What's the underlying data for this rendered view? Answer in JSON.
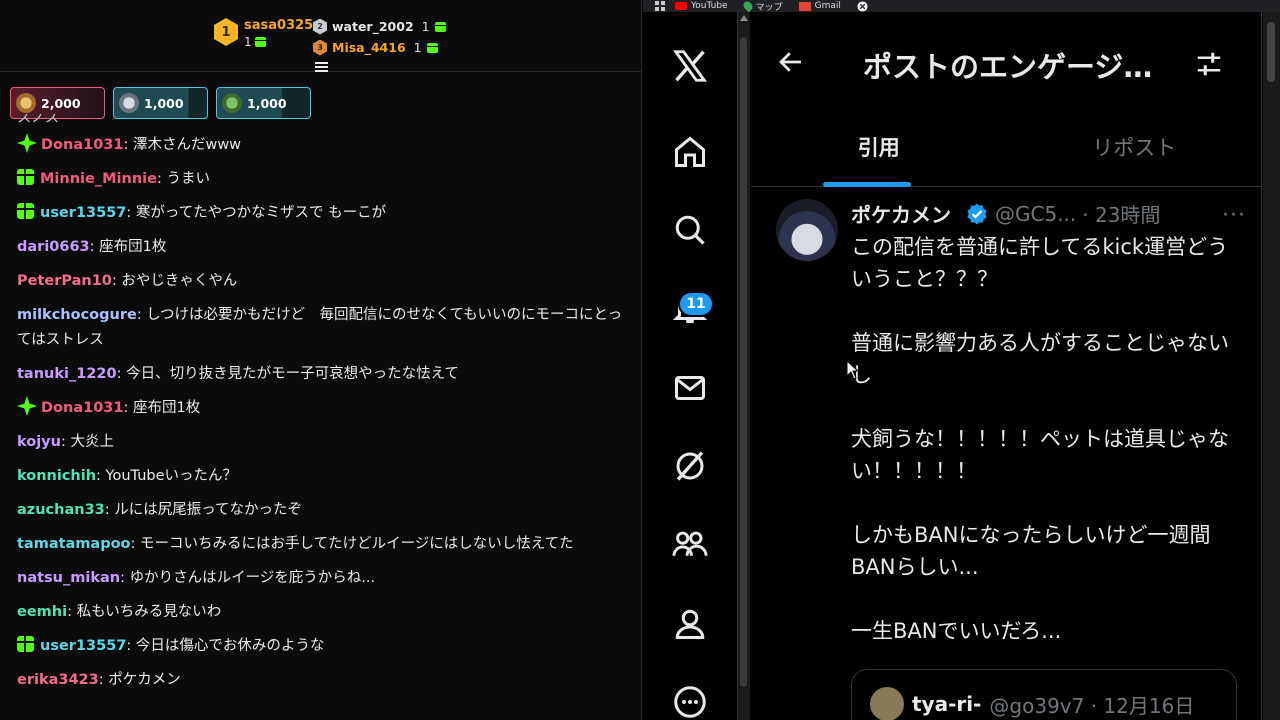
{
  "leaderboard": {
    "first": {
      "rank": "1",
      "name": "sasa0325",
      "gifts": "1"
    },
    "second": {
      "rank": "2",
      "name": "water_2002",
      "gifts": "1"
    },
    "third": {
      "rank": "3",
      "name": "Misa_4416",
      "gifts": "1"
    }
  },
  "pinned_gifts": [
    {
      "amount": "2,000"
    },
    {
      "amount": "1,000"
    },
    {
      "amount": "1,000"
    }
  ],
  "chat": {
    "cut_text": "スノス",
    "messages": [
      {
        "user": "Dona1031",
        "text": ": 澤木さんだwww",
        "color": "#f15b7d",
        "badge": "star"
      },
      {
        "user": "Minnie_Minnie",
        "text": ": うまい",
        "color": "#f15b7d",
        "badge": "gift"
      },
      {
        "user": "user13557",
        "text": ": 寒がってたやつかなミザスで もーこが",
        "color": "#5dd6e8",
        "badge": "gift"
      },
      {
        "user": "dari0663",
        "text": ": 座布団1枚",
        "color": "#c89cff",
        "badge": ""
      },
      {
        "user": "PeterPan10",
        "text": ": おやじきゃくやん",
        "color": "#f66c8c",
        "badge": ""
      },
      {
        "user": "milkchocogure",
        "text": ": しつけは必要かもだけど　毎回配信にのせなくてもいいのにモーコにとってはストレス",
        "color": "#a9c1ff",
        "badge": ""
      },
      {
        "user": "tanuki_1220",
        "text": ": 今日、切り抜き見たがモー子可哀想やったな怯えて",
        "color": "#c89cff",
        "badge": ""
      },
      {
        "user": "Dona1031",
        "text": ": 座布団1枚",
        "color": "#f15b7d",
        "badge": "star"
      },
      {
        "user": "kojyu",
        "text": ": 大炎上",
        "color": "#c89cff",
        "badge": ""
      },
      {
        "user": "konnichih",
        "text": ": YouTubeいったん？",
        "color": "#4fe3b8",
        "badge": ""
      },
      {
        "user": "azuchan33",
        "text": ": ルには尻尾振ってなかったぞ",
        "color": "#4fe3b8",
        "badge": ""
      },
      {
        "user": "tamatamapoo",
        "text": ": モーコいちみるにはお手してたけどルイージにはしないし怯えてた",
        "color": "#5dd6e8",
        "badge": ""
      },
      {
        "user": "natsu_mikan",
        "text": ": ゆかりさんはルイージを庇うからね...",
        "color": "#c89cff",
        "badge": ""
      },
      {
        "user": "eemhi",
        "text": ": 私もいちみる見ないわ",
        "color": "#4fe3b8",
        "badge": ""
      },
      {
        "user": "user13557",
        "text": ": 今日は傷心でお休みのような",
        "color": "#5dd6e8",
        "badge": "gift"
      },
      {
        "user": "erika3423",
        "text": ": ポケカメン",
        "color": "#f66c8c",
        "badge": ""
      }
    ]
  },
  "bookmarks": [
    {
      "label": "YouTube",
      "icon": "youtube-icon"
    },
    {
      "label": "マップ",
      "icon": "maps-icon"
    },
    {
      "label": "Gmail",
      "icon": "gmail-icon"
    }
  ],
  "x": {
    "notifications_count": "11",
    "header_title": "ポストのエンゲージメント",
    "tabs": [
      "引用",
      "リポスト"
    ],
    "post": {
      "name": "ポケカメン",
      "handle": "@GC5...",
      "time": "· 23時間",
      "paragraphs": [
        "この配信を普通に許してるkick運営どういうこと？？？",
        "普通に影響力ある人がすることじゃないし",
        "犬飼うな！！！！！ペットは道具じゃない！！！！！",
        "しかもBANになったらしいけど一週間BANらしい...",
        "一生BANでいいだろ..."
      ],
      "quote": {
        "name": "tya-ri-",
        "handle": "@go39v7 · 12月16日"
      }
    }
  },
  "colors": {
    "accent": "#1d9bf0",
    "kick_green": "#53fc18",
    "gold": "#f5a623"
  }
}
